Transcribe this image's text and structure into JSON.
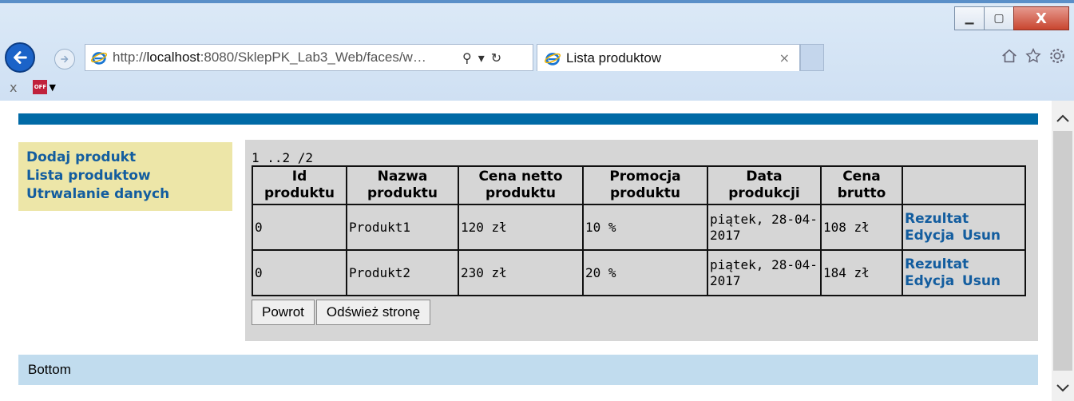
{
  "window": {
    "minimize_glyph": "▁",
    "maximize_glyph": "▢",
    "close_glyph": "X"
  },
  "address_bar": {
    "url_prefix": "http://",
    "url_host": "localhost",
    "url_rest": ":8080/SklepPK_Lab3_Web/faces/w…",
    "search_glyph": "⚲",
    "dropdown_glyph": "▾",
    "refresh_glyph": "↻"
  },
  "tab": {
    "title": "Lista produktow",
    "close_glyph": "×"
  },
  "command_bar": {
    "close_glyph": "x",
    "offer_text": "OFF",
    "caret": "▼"
  },
  "sidebar": {
    "items": [
      {
        "label": "Dodaj produkt"
      },
      {
        "label": "Lista produktow"
      },
      {
        "label": "Utrwalanie danych"
      }
    ]
  },
  "pager": "1 ..2 /2",
  "table": {
    "headers": [
      "Id produktu",
      "Nazwa produktu",
      "Cena netto produktu",
      "Promocja produktu",
      "Data produkcji",
      "Cena brutto",
      ""
    ],
    "rows": [
      {
        "id": "0",
        "name": "Produkt1",
        "net": "120 zł",
        "promo": "10 %",
        "date": "piątek, 28-04-2017",
        "gross": "108 zł",
        "actions": [
          "Rezultat",
          "Edycja",
          "Usun"
        ]
      },
      {
        "id": "0",
        "name": "Produkt2",
        "net": "230 zł",
        "promo": "20 %",
        "date": "piątek, 28-04-2017",
        "gross": "184 zł",
        "actions": [
          "Rezultat",
          "Edycja",
          "Usun"
        ]
      }
    ]
  },
  "buttons": {
    "back": "Powrot",
    "refresh": "Odśwież stronę"
  },
  "footer": {
    "text": "Bottom"
  }
}
